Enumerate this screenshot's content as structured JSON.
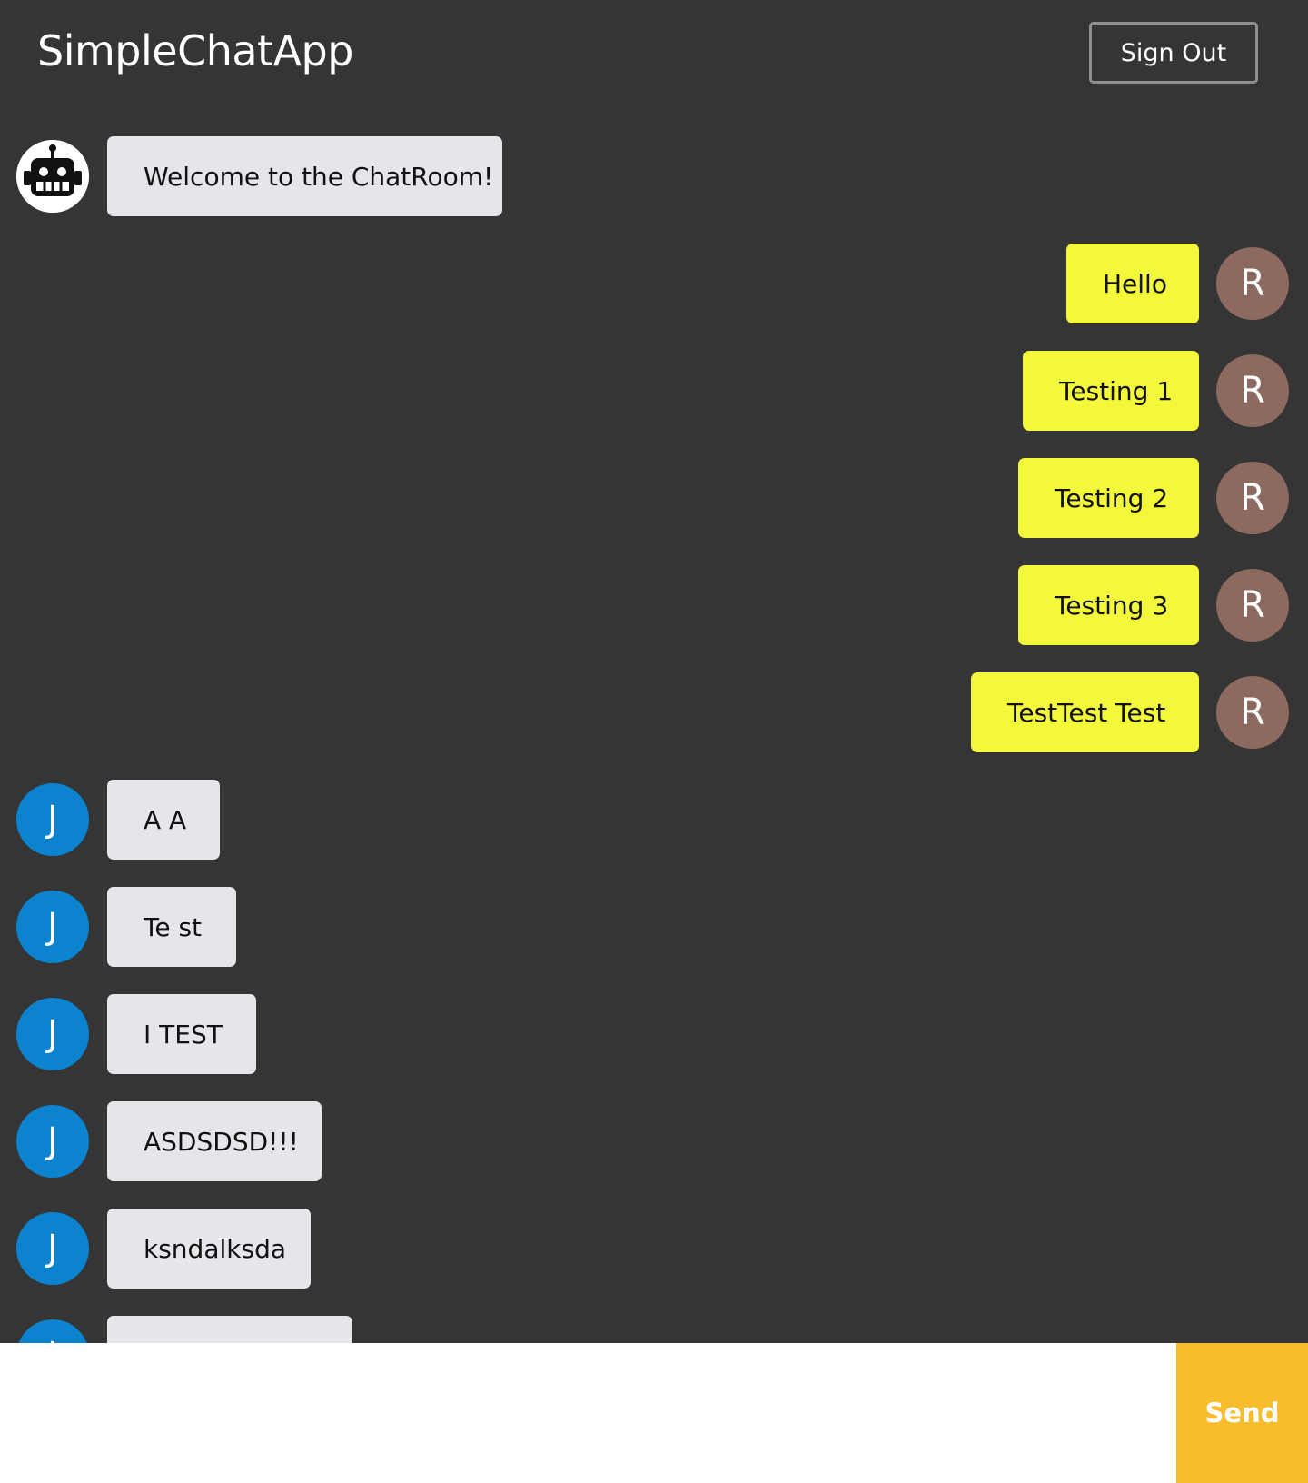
{
  "header": {
    "title": "SimpleChatApp",
    "signout_label": "Sign Out"
  },
  "messages": [
    {
      "sender": "bot",
      "avatar_icon": "robot-icon",
      "avatar_letter": "",
      "text": "Welcome to the ChatRoom!",
      "mine": false
    },
    {
      "sender": "R",
      "avatar_icon": "",
      "avatar_letter": "R",
      "text": "Hello",
      "mine": true
    },
    {
      "sender": "R",
      "avatar_icon": "",
      "avatar_letter": "R",
      "text": "Testing 1",
      "mine": true
    },
    {
      "sender": "R",
      "avatar_icon": "",
      "avatar_letter": "R",
      "text": "Testing 2",
      "mine": true
    },
    {
      "sender": "R",
      "avatar_icon": "",
      "avatar_letter": "R",
      "text": "Testing 3",
      "mine": true
    },
    {
      "sender": "R",
      "avatar_icon": "",
      "avatar_letter": "R",
      "text": "TestTest Test",
      "mine": true
    },
    {
      "sender": "J",
      "avatar_icon": "",
      "avatar_letter": "J",
      "text": "A A",
      "mine": false
    },
    {
      "sender": "J",
      "avatar_icon": "",
      "avatar_letter": "J",
      "text": "Te st",
      "mine": false
    },
    {
      "sender": "J",
      "avatar_icon": "",
      "avatar_letter": "J",
      "text": "I TEST",
      "mine": false
    },
    {
      "sender": "J",
      "avatar_icon": "",
      "avatar_letter": "J",
      "text": "ASDSDSD!!!",
      "mine": false
    },
    {
      "sender": "J",
      "avatar_icon": "",
      "avatar_letter": "J",
      "text": "ksndalksda",
      "mine": false
    },
    {
      "sender": "J",
      "avatar_icon": "",
      "avatar_letter": "J",
      "text": "",
      "mine": false
    }
  ],
  "composer": {
    "input_value": "",
    "send_label": "Send"
  },
  "colors": {
    "background": "#353535",
    "my_bubble": "#f4f83a",
    "other_bubble": "#e6e6ea",
    "avatar_r": "#8c6a5f",
    "avatar_j": "#0b83cf",
    "send_button": "#f8bd2d"
  }
}
